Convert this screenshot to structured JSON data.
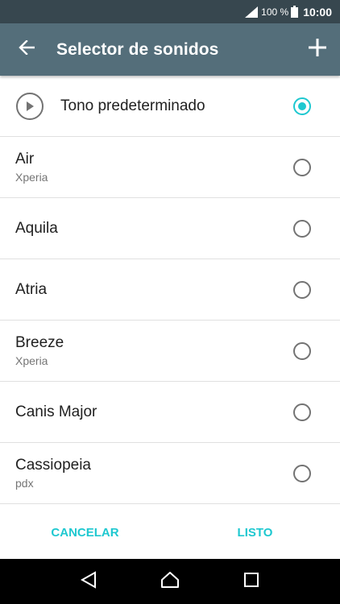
{
  "status_bar": {
    "battery_text": "100 %",
    "time": "10:00"
  },
  "app_bar": {
    "title": "Selector de sonidos",
    "back_icon": "arrow-left-icon",
    "add_icon": "plus-icon"
  },
  "default_tone": {
    "label": "Tono predeterminado",
    "selected": true
  },
  "sounds": [
    {
      "title": "Air",
      "subtitle": "Xperia"
    },
    {
      "title": "Aquila",
      "subtitle": ""
    },
    {
      "title": "Atria",
      "subtitle": ""
    },
    {
      "title": "Breeze",
      "subtitle": "Xperia"
    },
    {
      "title": "Canis Major",
      "subtitle": ""
    },
    {
      "title": "Cassiopeia",
      "subtitle": "pdx"
    }
  ],
  "footer": {
    "cancel_label": "CANCELAR",
    "done_label": "LISTO"
  },
  "colors": {
    "accent": "#1ec8d0",
    "app_bar": "#546e7a",
    "status_bar": "#37474f"
  }
}
